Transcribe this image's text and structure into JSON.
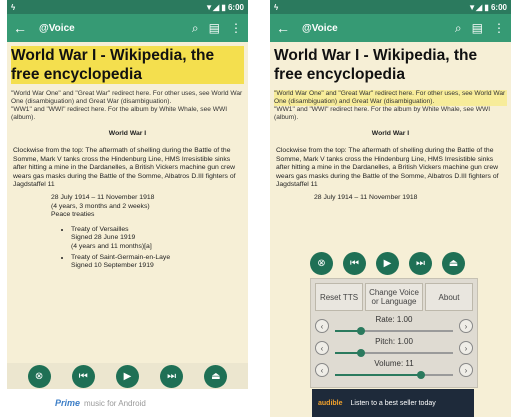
{
  "status": {
    "left": "ϟ",
    "right": "▼◢ ▮ 6:00"
  },
  "appbar": {
    "back": "←",
    "title": "@Voice",
    "search_icon": "⌕",
    "book_icon": "▤",
    "menu_icon": "⋮"
  },
  "article": {
    "title": "World War I - Wikipedia, the free encyclopedia",
    "redirect_p1": "\"World War One\" and \"Great War\" redirect here. For other uses, see World War One (disambiguation) and Great War (disambiguation).",
    "redirect_p2": "\"WW1\" and \"WWI\" redirect here. For the album by White Whale, see WWI (album).",
    "caption": "World War I",
    "description": "Clockwise from the top: The aftermath of shelling during the Battle of the Somme, Mark V tanks cross the Hindenburg Line, HMS Irresistible sinks after hitting a mine in the Dardanelles, a British Vickers machine gun crew wears gas masks during the Battle of the Somme, Albatros D.III fighters of Jagdstaffel 11",
    "dates": "28 July 1914 – 11 November 1918",
    "duration": "(4 years, 3 months and 2 weeks)",
    "peace": "Peace treaties",
    "treaty1": "Treaty of Versailles",
    "treaty1_signed": "Signed 28 June 1919",
    "treaty1_duration": "(4 years and 11 months)[a]",
    "treaty2": "Treaty of Saint-Germain-en-Laye",
    "treaty2_signed": "Signed 10 September 1919"
  },
  "controls": {
    "stop_icon": "⊗",
    "prev_icon": "⏮",
    "play_icon": "▶",
    "next_icon": "⏭",
    "eject_icon": "⏏"
  },
  "panel": {
    "reset": "Reset TTS",
    "change_voice": "Change Voice or Language",
    "about": "About",
    "rate_label": "Rate: 1.00",
    "pitch_label": "Pitch: 1.00",
    "volume_label": "Volume: 11",
    "rate_value": 0.22,
    "pitch_value": 0.22,
    "volume_value": 0.73,
    "left_arrow": "‹",
    "right_arrow": "›"
  },
  "ads": {
    "left_brand": "Prime",
    "left_sub": "music for Android",
    "right_logo": "audible",
    "right_text": "Listen to a best seller today"
  }
}
